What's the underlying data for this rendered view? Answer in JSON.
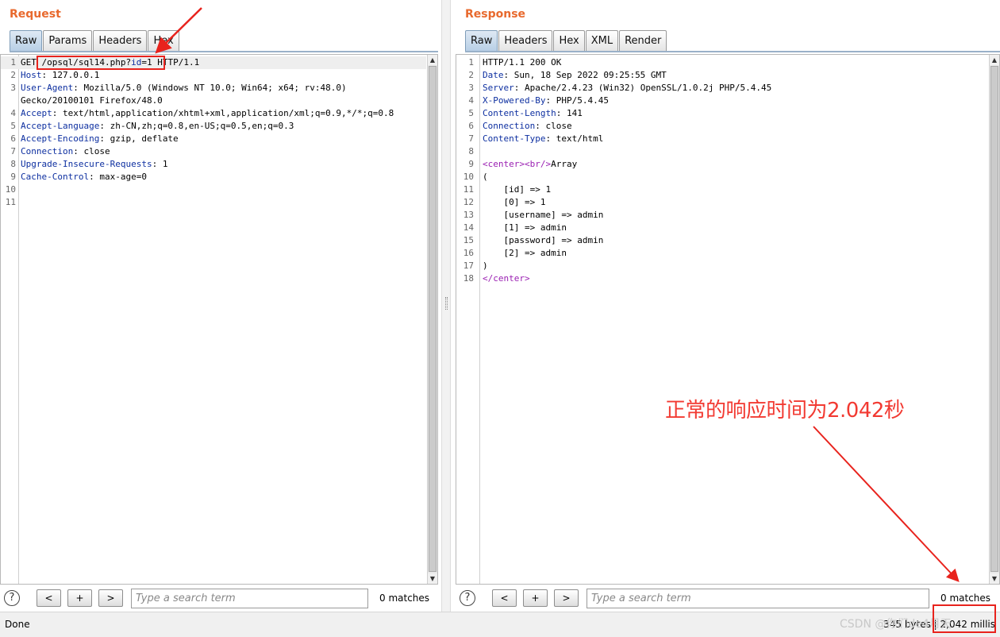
{
  "request": {
    "title": "Request",
    "tabs": [
      "Raw",
      "Params",
      "Headers",
      "Hex"
    ],
    "lines": [
      {
        "n": "1",
        "parts": [
          {
            "t": "GET "
          },
          {
            "t": "/opsql/sql14.php?"
          },
          {
            "t": "id",
            "k": "hk"
          },
          {
            "t": "=1"
          },
          {
            "t": " HTTP/1.1"
          }
        ]
      },
      {
        "n": "2",
        "parts": [
          {
            "t": "Host",
            "k": "hk"
          },
          {
            "t": ": 127.0.0.1"
          }
        ]
      },
      {
        "n": "3",
        "parts": [
          {
            "t": "User-Agent",
            "k": "hk"
          },
          {
            "t": ": Mozilla/5.0 (Windows NT 10.0; Win64; x64; rv:48.0)"
          }
        ]
      },
      {
        "n": "",
        "parts": [
          {
            "t": "Gecko/20100101 Firefox/48.0"
          }
        ]
      },
      {
        "n": "4",
        "parts": [
          {
            "t": "Accept",
            "k": "hk"
          },
          {
            "t": ": text/html,application/xhtml+xml,application/xml;q=0.9,*/*;q=0.8"
          }
        ]
      },
      {
        "n": "5",
        "parts": [
          {
            "t": "Accept-Language",
            "k": "hk"
          },
          {
            "t": ": zh-CN,zh;q=0.8,en-US;q=0.5,en;q=0.3"
          }
        ]
      },
      {
        "n": "6",
        "parts": [
          {
            "t": "Accept-Encoding",
            "k": "hk"
          },
          {
            "t": ": gzip, deflate"
          }
        ]
      },
      {
        "n": "7",
        "parts": [
          {
            "t": "Connection",
            "k": "hk"
          },
          {
            "t": ": close"
          }
        ]
      },
      {
        "n": "8",
        "parts": [
          {
            "t": "Upgrade-Insecure-Requests",
            "k": "hk"
          },
          {
            "t": ": 1"
          }
        ]
      },
      {
        "n": "9",
        "parts": [
          {
            "t": "Cache-Control",
            "k": "hk"
          },
          {
            "t": ": max-age=0"
          }
        ]
      },
      {
        "n": "10",
        "parts": []
      },
      {
        "n": "11",
        "parts": []
      }
    ],
    "search_placeholder": "Type a search term",
    "matches": "0 matches"
  },
  "response": {
    "title": "Response",
    "tabs": [
      "Raw",
      "Headers",
      "Hex",
      "XML",
      "Render"
    ],
    "lines": [
      {
        "n": "1",
        "parts": [
          {
            "t": "HTTP/1.1 200 OK"
          }
        ]
      },
      {
        "n": "2",
        "parts": [
          {
            "t": "Date",
            "k": "hk"
          },
          {
            "t": ": Sun, 18 Sep 2022 09:25:55 GMT"
          }
        ]
      },
      {
        "n": "3",
        "parts": [
          {
            "t": "Server",
            "k": "hk"
          },
          {
            "t": ": Apache/2.4.23 (Win32) OpenSSL/1.0.2j PHP/5.4.45"
          }
        ]
      },
      {
        "n": "4",
        "parts": [
          {
            "t": "X-Powered-By",
            "k": "hk"
          },
          {
            "t": ": PHP/5.4.45"
          }
        ]
      },
      {
        "n": "5",
        "parts": [
          {
            "t": "Content-Length",
            "k": "hk"
          },
          {
            "t": ": 141"
          }
        ]
      },
      {
        "n": "6",
        "parts": [
          {
            "t": "Connection",
            "k": "hk"
          },
          {
            "t": ": close"
          }
        ]
      },
      {
        "n": "7",
        "parts": [
          {
            "t": "Content-Type",
            "k": "hk"
          },
          {
            "t": ": text/html"
          }
        ]
      },
      {
        "n": "8",
        "parts": []
      },
      {
        "n": "9",
        "parts": [
          {
            "t": "<center>",
            "k": "tg"
          },
          {
            "t": "<br/>",
            "k": "tg"
          },
          {
            "t": "Array"
          }
        ]
      },
      {
        "n": "10",
        "parts": [
          {
            "t": "("
          }
        ]
      },
      {
        "n": "11",
        "parts": [
          {
            "t": "    [id] => 1"
          }
        ]
      },
      {
        "n": "12",
        "parts": [
          {
            "t": "    [0] => 1"
          }
        ]
      },
      {
        "n": "13",
        "parts": [
          {
            "t": "    [username] => admin"
          }
        ]
      },
      {
        "n": "14",
        "parts": [
          {
            "t": "    [1] => admin"
          }
        ]
      },
      {
        "n": "15",
        "parts": [
          {
            "t": "    [password] => admin"
          }
        ]
      },
      {
        "n": "16",
        "parts": [
          {
            "t": "    [2] => admin"
          }
        ]
      },
      {
        "n": "17",
        "parts": [
          {
            "t": ")"
          }
        ]
      },
      {
        "n": "18",
        "parts": [
          {
            "t": "</center>",
            "k": "tg"
          }
        ]
      }
    ],
    "search_placeholder": "Type a search term",
    "matches": "0 matches"
  },
  "search_nav": {
    "help": "?",
    "prev": "<",
    "add": "+",
    "next": ">"
  },
  "status": {
    "left": "Done",
    "right": "345 bytes | 2,042 millis"
  },
  "annotation": "正常的响应时间为2.042秒",
  "watermark": "CSDN @你们de4月天",
  "colors": {
    "title": "#e8692d",
    "header_key": "#0d2fa0",
    "tag": "#9a1fb2",
    "annotation": "#e8231d"
  }
}
